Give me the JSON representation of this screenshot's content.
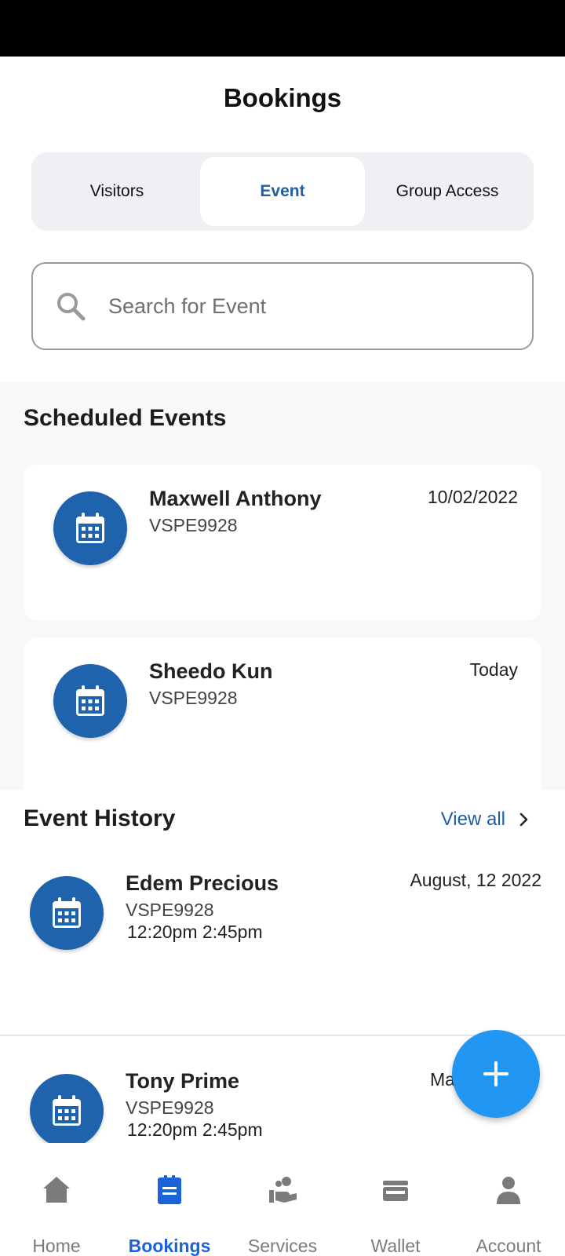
{
  "header": {
    "title": "Bookings"
  },
  "tabs": [
    {
      "label": "Visitors"
    },
    {
      "label": "Event"
    },
    {
      "label": "Group Access"
    }
  ],
  "search": {
    "placeholder": "Search for Event"
  },
  "scheduled": {
    "title": "Scheduled Events",
    "items": [
      {
        "name": "Maxwell Anthony",
        "code": "VSPE9928",
        "date": "10/02/2022"
      },
      {
        "name": "Sheedo Kun",
        "code": "VSPE9928",
        "date": "Today"
      }
    ]
  },
  "history": {
    "title": "Event History",
    "view_all": "View all",
    "items": [
      {
        "name": "Edem Precious",
        "code": "VSPE9928",
        "times": "12:20pm  2:45pm",
        "date": "August, 12 2022"
      },
      {
        "name": "Tony Prime",
        "code": "VSPE9928",
        "times": "12:20pm  2:45pm",
        "date": "Ma"
      }
    ]
  },
  "nav": [
    {
      "label": "Home",
      "icon": "home-icon"
    },
    {
      "label": "Bookings",
      "icon": "bookings-icon"
    },
    {
      "label": "Services",
      "icon": "services-icon"
    },
    {
      "label": "Wallet",
      "icon": "wallet-icon"
    },
    {
      "label": "Account",
      "icon": "account-icon"
    }
  ],
  "colors": {
    "accent": "#1f5fa3",
    "avatar": "#1f63ad",
    "fab": "#2196f3",
    "nav_active": "#1a63d8",
    "nav_inactive": "#7b7b7b"
  }
}
